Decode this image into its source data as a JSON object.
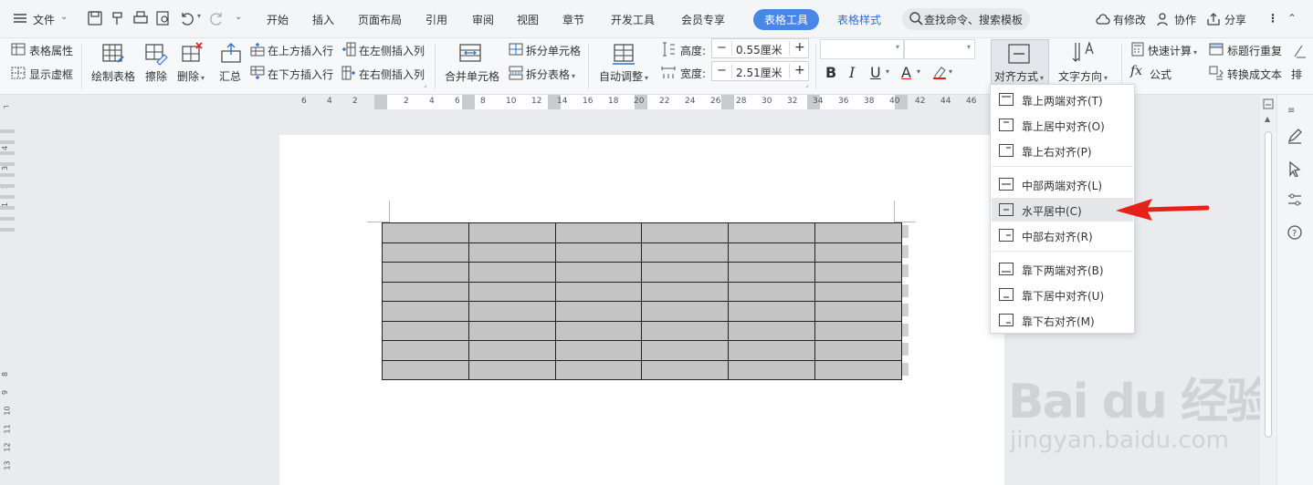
{
  "menubar": {
    "file": "文件",
    "tabs": [
      "开始",
      "插入",
      "页面布局",
      "引用",
      "审阅",
      "视图",
      "章节",
      "开发工具",
      "会员专享"
    ],
    "active_tab": "表格工具",
    "tab_style": "表格样式",
    "search": "查找命令、搜索模板",
    "modified": "有修改",
    "collab": "协作",
    "share": "分享"
  },
  "ribbon": {
    "table_props": "表格属性",
    "show_grid": "显示虚框",
    "draw_table": "绘制表格",
    "erase": "擦除",
    "delete": "删除",
    "summary": "汇总",
    "insert_above": "在上方插入行",
    "insert_below": "在下方插入行",
    "insert_left": "在左侧插入列",
    "insert_right": "在右侧插入列",
    "merge": "合并单元格",
    "split_cell": "拆分单元格",
    "split_table": "拆分表格",
    "auto_fit": "自动调整",
    "height_label": "高度:",
    "height_value": "0.55厘米",
    "width_label": "宽度:",
    "width_value": "2.51厘米",
    "align": "对齐方式",
    "text_dir": "文字方向",
    "quick_calc": "快速计算",
    "title_repeat": "标题行重复",
    "formula": "公式",
    "to_text": "转换成文本",
    "sort": "排"
  },
  "ruler": {
    "ticks": [
      "6",
      "4",
      "2",
      "2",
      "4",
      "6",
      "8",
      "10",
      "12",
      "14",
      "16",
      "18",
      "20",
      "22",
      "24",
      "26",
      "28",
      "30",
      "32",
      "34",
      "36",
      "38",
      "40",
      "42",
      "44",
      "46"
    ]
  },
  "vruler": {
    "ticks": [
      "4",
      "3",
      "2",
      "1",
      "8",
      "9",
      "10",
      "11",
      "12",
      "13"
    ]
  },
  "dropdown": {
    "items": [
      "靠上两端对齐(T)",
      "靠上居中对齐(O)",
      "靠上右对齐(P)",
      "中部两端对齐(L)",
      "水平居中(C)",
      "中部右对齐(R)",
      "靠下两端对齐(B)",
      "靠下居中对齐(U)",
      "靠下右对齐(M)"
    ],
    "highlighted_index": 4
  },
  "table": {
    "rows": 8,
    "cols": 6
  },
  "watermark": {
    "logo": "Bai du 经验",
    "url": "jingyan.baidu.com"
  },
  "colors": {
    "accent": "#4a86e8",
    "arrow": "#e8201a",
    "cell": "#c4c4c4"
  }
}
